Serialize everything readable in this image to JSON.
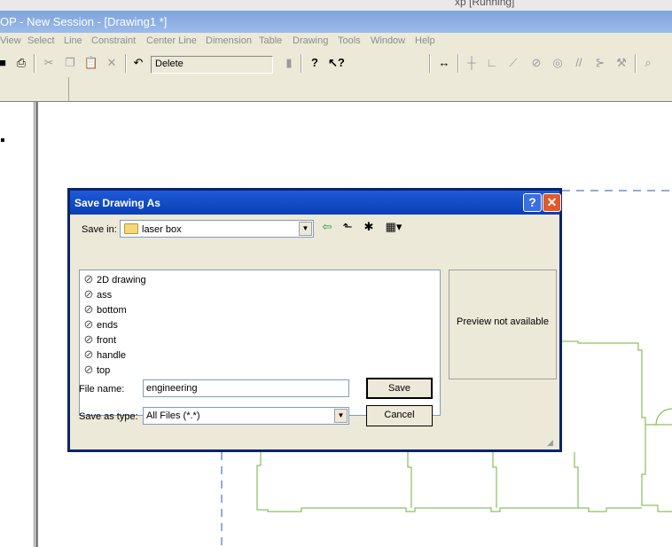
{
  "host": {
    "title": "xp [Running]"
  },
  "app": {
    "title": "OP - New Session - [Drawing1 *]",
    "menu": [
      "View",
      "Select",
      "Line",
      "Constraint",
      "Center Line",
      "Dimension",
      "Table",
      "Drawing",
      "Tools",
      "Window",
      "Help"
    ],
    "undo_combo": "Delete"
  },
  "dialog": {
    "title": "Save Drawing As",
    "save_in_label": "Save in:",
    "save_in_value": "laser box",
    "files": [
      "2D drawing",
      "ass",
      "bottom",
      "ends",
      "front",
      "handle",
      "top"
    ],
    "preview_text": "Preview not available",
    "file_name_label": "File name:",
    "file_name_value": "engineering",
    "save_as_type_label": "Save as type:",
    "save_as_type_value": "All Files (*.*)",
    "save_button": "Save",
    "cancel_button": "Cancel",
    "help_button": "?",
    "close_button": "✕"
  },
  "colors": {
    "drawing_line": "#6fb33a",
    "centerline": "#2a5aa8"
  }
}
